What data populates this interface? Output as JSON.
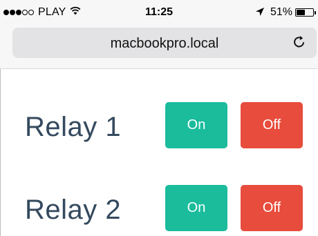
{
  "status_bar": {
    "signal_dots": [
      true,
      true,
      true,
      false,
      false
    ],
    "carrier": "PLAY",
    "wifi_icon": "wifi-icon",
    "time": "11:25",
    "location_icon": "location-arrow-icon",
    "battery_percent": "51%",
    "battery_level": 0.51
  },
  "browser": {
    "url": "macbookpro.local",
    "reload_icon": "reload-icon"
  },
  "relays": [
    {
      "label": "Relay 1",
      "on_label": "On",
      "off_label": "Off"
    },
    {
      "label": "Relay 2",
      "on_label": "On",
      "off_label": "Off"
    }
  ],
  "colors": {
    "on": "#1abc9c",
    "off": "#e74c3c",
    "label": "#34495e"
  }
}
